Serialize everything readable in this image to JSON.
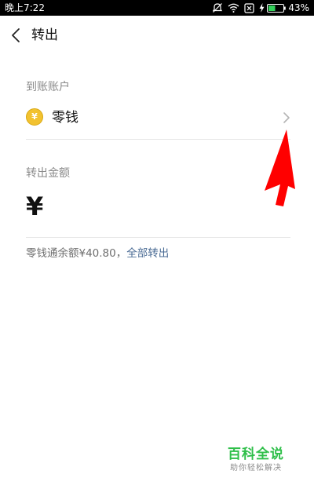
{
  "status_bar": {
    "time": "晚上7:22",
    "battery_percent": "43%",
    "icons": [
      "mute-icon",
      "wifi-icon",
      "sim-x-icon",
      "charging-icon",
      "battery-icon"
    ]
  },
  "header": {
    "back_icon": "chevron-left-icon",
    "title": "转出"
  },
  "account": {
    "section_label": "到账账户",
    "name": "零钱",
    "icon": "coin-icon",
    "icon_glyph": "¥",
    "chevron_icon": "chevron-right-icon"
  },
  "amount": {
    "section_label": "转出金额",
    "currency_symbol": "¥"
  },
  "balance": {
    "text": "零钱通余额¥40.80，",
    "transfer_all_label": "全部转出"
  },
  "watermark": {
    "title": "百科全说",
    "subtitle": "助你轻松解决"
  },
  "colors": {
    "link": "#4a6b94",
    "annotation_arrow": "#ff0000",
    "watermark_green": "#2fbf4a",
    "coin": "#f2c230"
  }
}
